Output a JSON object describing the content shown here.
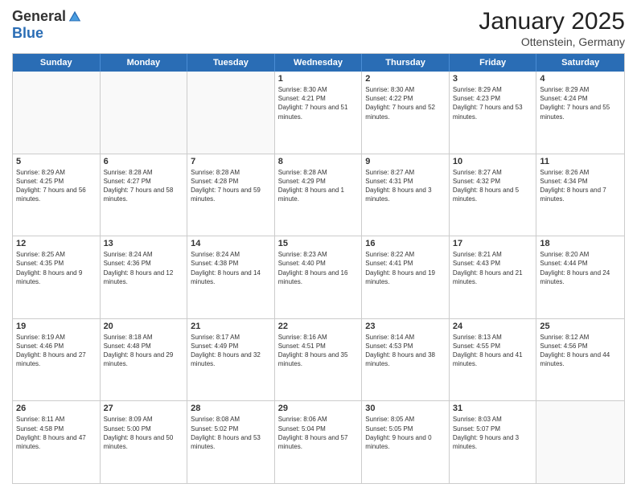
{
  "logo": {
    "general": "General",
    "blue": "Blue"
  },
  "header": {
    "title": "January 2025",
    "subtitle": "Ottenstein, Germany"
  },
  "weekdays": [
    "Sunday",
    "Monday",
    "Tuesday",
    "Wednesday",
    "Thursday",
    "Friday",
    "Saturday"
  ],
  "rows": [
    [
      {
        "day": "",
        "empty": true
      },
      {
        "day": "",
        "empty": true
      },
      {
        "day": "",
        "empty": true
      },
      {
        "day": "1",
        "sunrise": "Sunrise: 8:30 AM",
        "sunset": "Sunset: 4:21 PM",
        "daylight": "Daylight: 7 hours and 51 minutes."
      },
      {
        "day": "2",
        "sunrise": "Sunrise: 8:30 AM",
        "sunset": "Sunset: 4:22 PM",
        "daylight": "Daylight: 7 hours and 52 minutes."
      },
      {
        "day": "3",
        "sunrise": "Sunrise: 8:29 AM",
        "sunset": "Sunset: 4:23 PM",
        "daylight": "Daylight: 7 hours and 53 minutes."
      },
      {
        "day": "4",
        "sunrise": "Sunrise: 8:29 AM",
        "sunset": "Sunset: 4:24 PM",
        "daylight": "Daylight: 7 hours and 55 minutes."
      }
    ],
    [
      {
        "day": "5",
        "sunrise": "Sunrise: 8:29 AM",
        "sunset": "Sunset: 4:25 PM",
        "daylight": "Daylight: 7 hours and 56 minutes."
      },
      {
        "day": "6",
        "sunrise": "Sunrise: 8:28 AM",
        "sunset": "Sunset: 4:27 PM",
        "daylight": "Daylight: 7 hours and 58 minutes."
      },
      {
        "day": "7",
        "sunrise": "Sunrise: 8:28 AM",
        "sunset": "Sunset: 4:28 PM",
        "daylight": "Daylight: 7 hours and 59 minutes."
      },
      {
        "day": "8",
        "sunrise": "Sunrise: 8:28 AM",
        "sunset": "Sunset: 4:29 PM",
        "daylight": "Daylight: 8 hours and 1 minute."
      },
      {
        "day": "9",
        "sunrise": "Sunrise: 8:27 AM",
        "sunset": "Sunset: 4:31 PM",
        "daylight": "Daylight: 8 hours and 3 minutes."
      },
      {
        "day": "10",
        "sunrise": "Sunrise: 8:27 AM",
        "sunset": "Sunset: 4:32 PM",
        "daylight": "Daylight: 8 hours and 5 minutes."
      },
      {
        "day": "11",
        "sunrise": "Sunrise: 8:26 AM",
        "sunset": "Sunset: 4:34 PM",
        "daylight": "Daylight: 8 hours and 7 minutes."
      }
    ],
    [
      {
        "day": "12",
        "sunrise": "Sunrise: 8:25 AM",
        "sunset": "Sunset: 4:35 PM",
        "daylight": "Daylight: 8 hours and 9 minutes."
      },
      {
        "day": "13",
        "sunrise": "Sunrise: 8:24 AM",
        "sunset": "Sunset: 4:36 PM",
        "daylight": "Daylight: 8 hours and 12 minutes."
      },
      {
        "day": "14",
        "sunrise": "Sunrise: 8:24 AM",
        "sunset": "Sunset: 4:38 PM",
        "daylight": "Daylight: 8 hours and 14 minutes."
      },
      {
        "day": "15",
        "sunrise": "Sunrise: 8:23 AM",
        "sunset": "Sunset: 4:40 PM",
        "daylight": "Daylight: 8 hours and 16 minutes."
      },
      {
        "day": "16",
        "sunrise": "Sunrise: 8:22 AM",
        "sunset": "Sunset: 4:41 PM",
        "daylight": "Daylight: 8 hours and 19 minutes."
      },
      {
        "day": "17",
        "sunrise": "Sunrise: 8:21 AM",
        "sunset": "Sunset: 4:43 PM",
        "daylight": "Daylight: 8 hours and 21 minutes."
      },
      {
        "day": "18",
        "sunrise": "Sunrise: 8:20 AM",
        "sunset": "Sunset: 4:44 PM",
        "daylight": "Daylight: 8 hours and 24 minutes."
      }
    ],
    [
      {
        "day": "19",
        "sunrise": "Sunrise: 8:19 AM",
        "sunset": "Sunset: 4:46 PM",
        "daylight": "Daylight: 8 hours and 27 minutes."
      },
      {
        "day": "20",
        "sunrise": "Sunrise: 8:18 AM",
        "sunset": "Sunset: 4:48 PM",
        "daylight": "Daylight: 8 hours and 29 minutes."
      },
      {
        "day": "21",
        "sunrise": "Sunrise: 8:17 AM",
        "sunset": "Sunset: 4:49 PM",
        "daylight": "Daylight: 8 hours and 32 minutes."
      },
      {
        "day": "22",
        "sunrise": "Sunrise: 8:16 AM",
        "sunset": "Sunset: 4:51 PM",
        "daylight": "Daylight: 8 hours and 35 minutes."
      },
      {
        "day": "23",
        "sunrise": "Sunrise: 8:14 AM",
        "sunset": "Sunset: 4:53 PM",
        "daylight": "Daylight: 8 hours and 38 minutes."
      },
      {
        "day": "24",
        "sunrise": "Sunrise: 8:13 AM",
        "sunset": "Sunset: 4:55 PM",
        "daylight": "Daylight: 8 hours and 41 minutes."
      },
      {
        "day": "25",
        "sunrise": "Sunrise: 8:12 AM",
        "sunset": "Sunset: 4:56 PM",
        "daylight": "Daylight: 8 hours and 44 minutes."
      }
    ],
    [
      {
        "day": "26",
        "sunrise": "Sunrise: 8:11 AM",
        "sunset": "Sunset: 4:58 PM",
        "daylight": "Daylight: 8 hours and 47 minutes."
      },
      {
        "day": "27",
        "sunrise": "Sunrise: 8:09 AM",
        "sunset": "Sunset: 5:00 PM",
        "daylight": "Daylight: 8 hours and 50 minutes."
      },
      {
        "day": "28",
        "sunrise": "Sunrise: 8:08 AM",
        "sunset": "Sunset: 5:02 PM",
        "daylight": "Daylight: 8 hours and 53 minutes."
      },
      {
        "day": "29",
        "sunrise": "Sunrise: 8:06 AM",
        "sunset": "Sunset: 5:04 PM",
        "daylight": "Daylight: 8 hours and 57 minutes."
      },
      {
        "day": "30",
        "sunrise": "Sunrise: 8:05 AM",
        "sunset": "Sunset: 5:05 PM",
        "daylight": "Daylight: 9 hours and 0 minutes."
      },
      {
        "day": "31",
        "sunrise": "Sunrise: 8:03 AM",
        "sunset": "Sunset: 5:07 PM",
        "daylight": "Daylight: 9 hours and 3 minutes."
      },
      {
        "day": "",
        "empty": true
      }
    ]
  ]
}
